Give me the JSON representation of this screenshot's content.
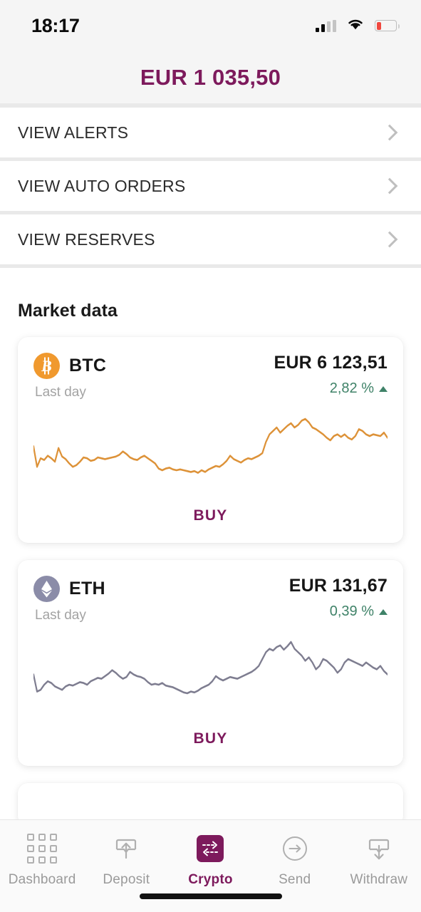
{
  "status_bar": {
    "time": "18:17",
    "signal_icon": "cellular-signal-icon",
    "wifi_icon": "wifi-icon",
    "battery_icon": "battery-low-icon",
    "battery_color": "#f0473e"
  },
  "header": {
    "balance": "EUR 1 035,50",
    "balance_color": "#7d1a5c"
  },
  "menu": {
    "items": [
      {
        "label": "VIEW ALERTS",
        "chevron": "chevron-right-icon"
      },
      {
        "label": "VIEW AUTO ORDERS",
        "chevron": "chevron-right-icon"
      },
      {
        "label": "VIEW RESERVES",
        "chevron": "chevron-right-icon"
      }
    ]
  },
  "main": {
    "section_title": "Market data",
    "cards": [
      {
        "symbol": "BTC",
        "logo_icon": "bitcoin-logo-icon",
        "logo_color": "#f0992e",
        "period_label": "Last day",
        "price": "EUR 6 123,51",
        "change": "2,82 %",
        "change_direction": "up",
        "change_color": "#3f8268",
        "buy_label": "BUY",
        "line_color": "#dd9238"
      },
      {
        "symbol": "ETH",
        "logo_icon": "ethereum-logo-icon",
        "logo_color": "#8b8ca8",
        "period_label": "Last day",
        "price": "EUR 131,67",
        "change": "0,39 %",
        "change_direction": "up",
        "change_color": "#3f8268",
        "buy_label": "BUY",
        "line_color": "#7e7d90"
      }
    ]
  },
  "chart_data": [
    {
      "type": "line",
      "title": "BTC Last day sparkline",
      "xlabel": "",
      "ylabel": "",
      "grid": false,
      "legend": "none",
      "series_name": "BTC",
      "color": "#dd9238",
      "ylim": [
        0,
        100
      ],
      "values": [
        58,
        34,
        44,
        42,
        47,
        44,
        40,
        56,
        46,
        43,
        38,
        34,
        36,
        40,
        45,
        44,
        41,
        42,
        45,
        44,
        43,
        44,
        45,
        46,
        48,
        52,
        49,
        45,
        43,
        42,
        45,
        47,
        44,
        41,
        38,
        32,
        30,
        32,
        33,
        31,
        30,
        31,
        30,
        29,
        28,
        29,
        27,
        30,
        28,
        31,
        33,
        35,
        34,
        37,
        41,
        47,
        43,
        41,
        39,
        42,
        44,
        43,
        45,
        47,
        50,
        63,
        72,
        76,
        80,
        74,
        78,
        82,
        85,
        80,
        83,
        88,
        90,
        86,
        80,
        78,
        75,
        72,
        68,
        65,
        70,
        72,
        69,
        72,
        68,
        66,
        70,
        78,
        76,
        72,
        70,
        72,
        71,
        70,
        74,
        68
      ]
    },
    {
      "type": "line",
      "title": "ETH Last day sparkline",
      "xlabel": "",
      "ylabel": "",
      "grid": false,
      "legend": "none",
      "series_name": "ETH",
      "color": "#7e7d90",
      "ylim": [
        0,
        100
      ],
      "values": [
        52,
        32,
        34,
        40,
        44,
        42,
        38,
        36,
        34,
        38,
        40,
        39,
        41,
        43,
        42,
        40,
        44,
        46,
        48,
        47,
        50,
        53,
        57,
        54,
        50,
        47,
        49,
        55,
        52,
        50,
        49,
        47,
        43,
        40,
        41,
        40,
        42,
        39,
        38,
        37,
        35,
        33,
        31,
        30,
        32,
        31,
        33,
        36,
        38,
        40,
        44,
        50,
        47,
        45,
        47,
        49,
        48,
        47,
        49,
        51,
        53,
        55,
        58,
        62,
        70,
        78,
        82,
        80,
        84,
        86,
        81,
        85,
        90,
        82,
        78,
        74,
        68,
        72,
        66,
        58,
        62,
        70,
        68,
        64,
        60,
        54,
        58,
        66,
        70,
        68,
        66,
        64,
        62,
        66,
        63,
        60,
        58,
        62,
        56,
        52
      ]
    }
  ],
  "tabbar": {
    "tabs": [
      {
        "label": "Dashboard",
        "icon": "grid-icon",
        "active": false
      },
      {
        "label": "Deposit",
        "icon": "upload-box-icon",
        "active": false
      },
      {
        "label": "Crypto",
        "icon": "exchange-arrows-icon",
        "active": true
      },
      {
        "label": "Send",
        "icon": "arrow-right-circle-icon",
        "active": false
      },
      {
        "label": "Withdraw",
        "icon": "download-box-icon",
        "active": false
      }
    ],
    "active_color": "#7d1a5c"
  }
}
